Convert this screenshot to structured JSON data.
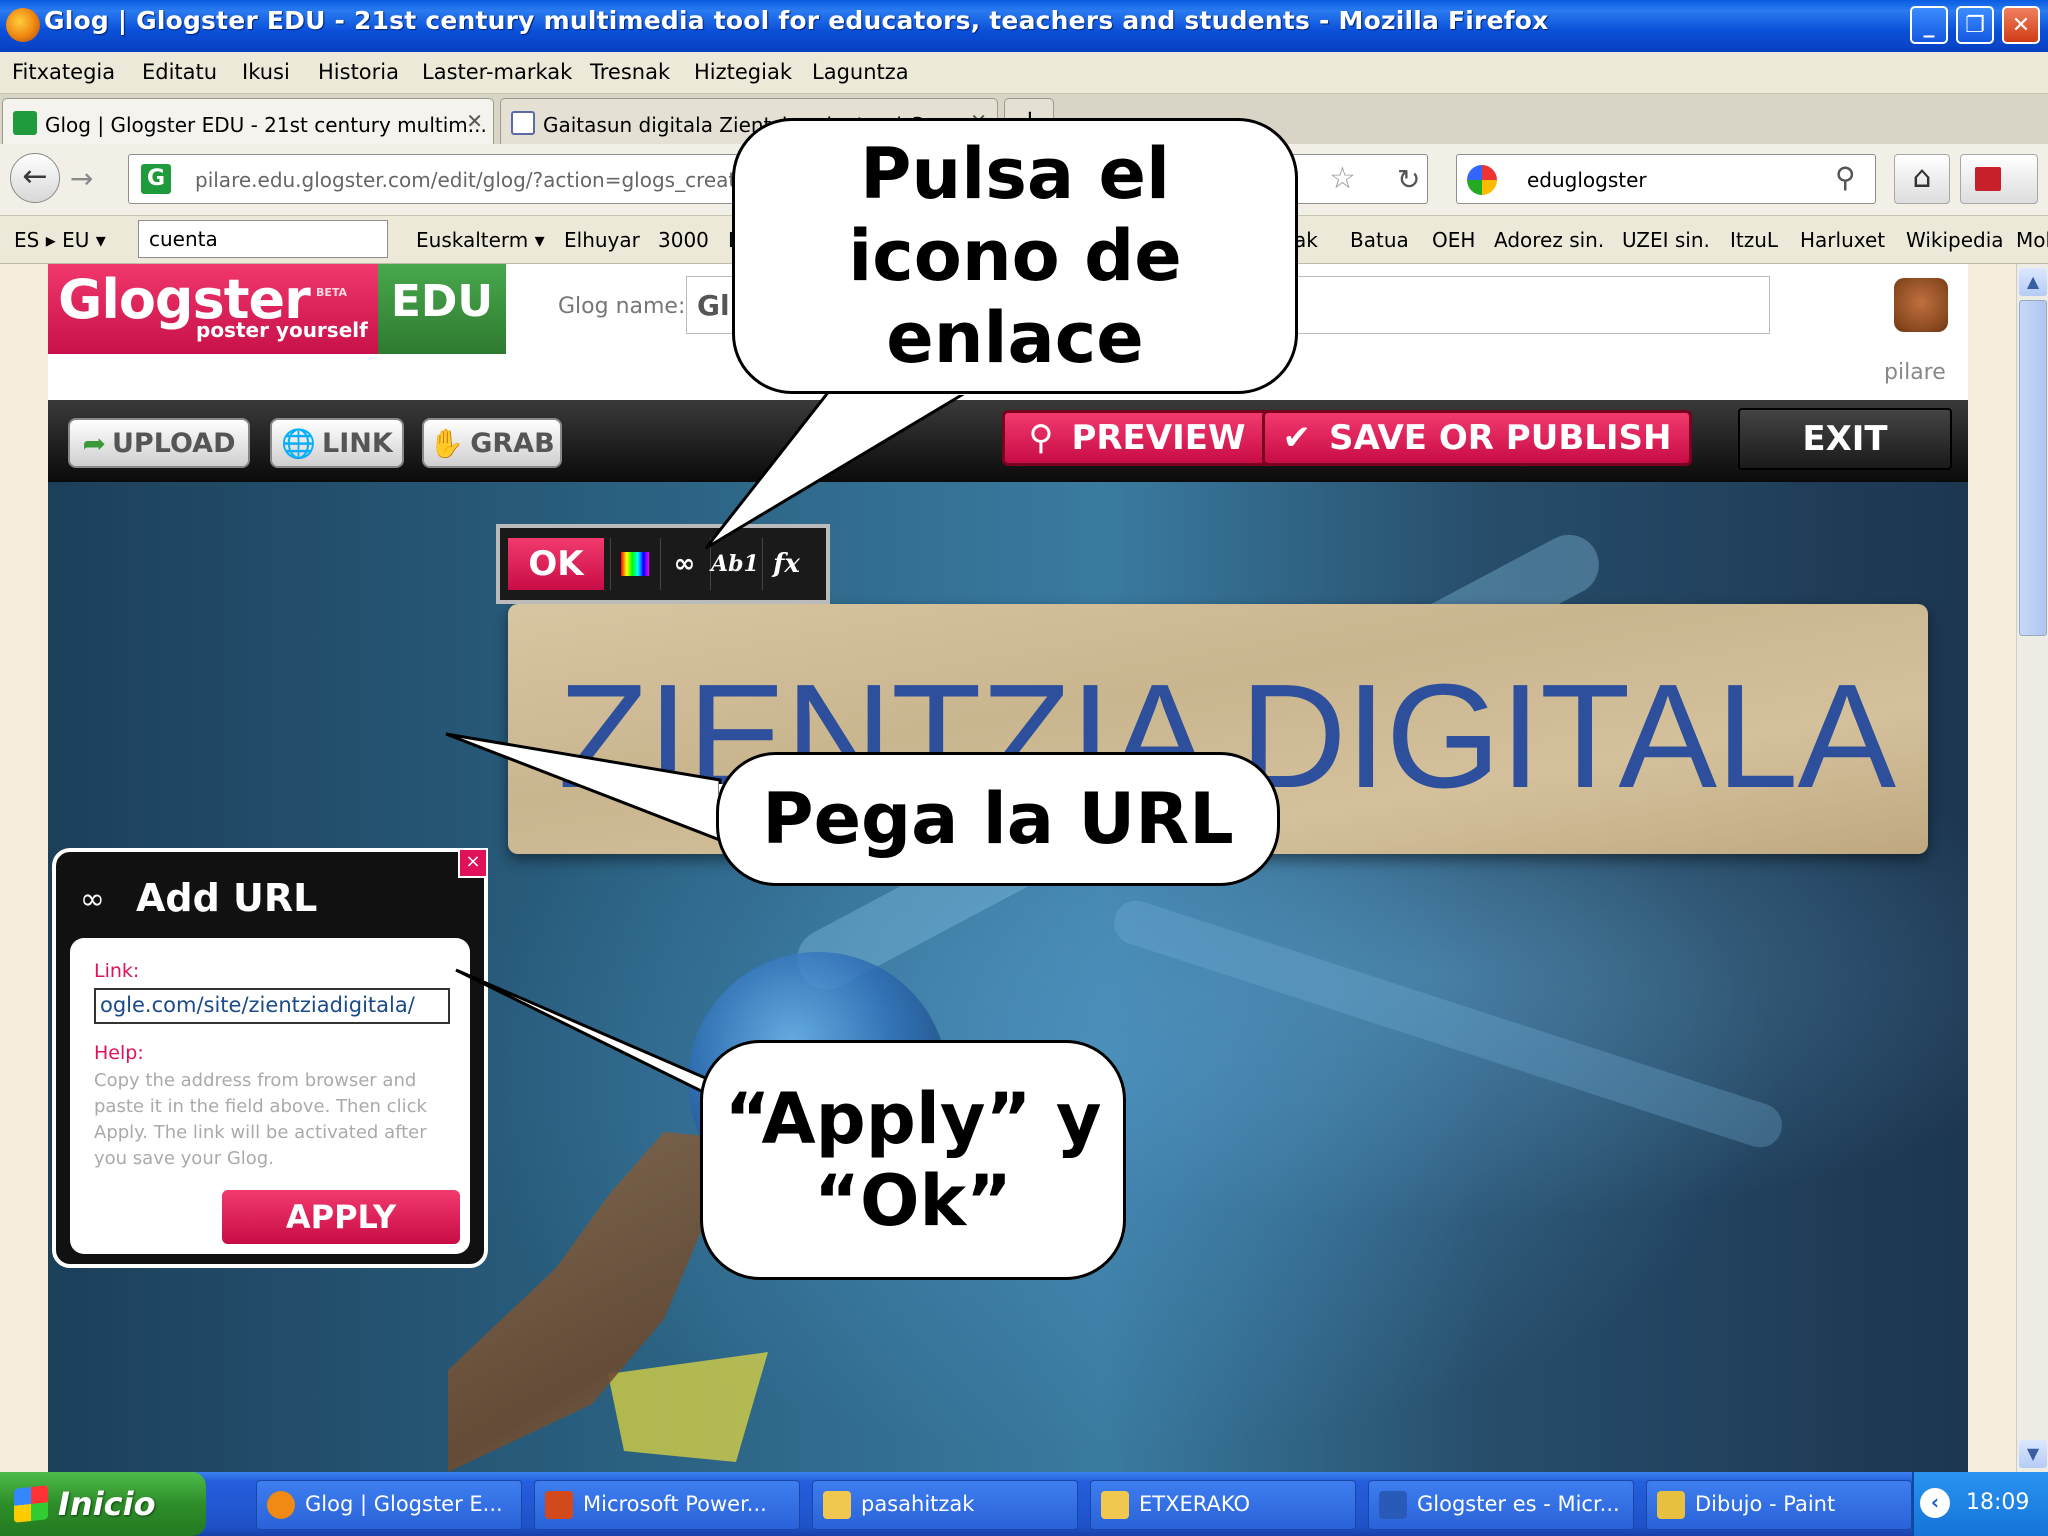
{
  "window": {
    "title": "Glog | Glogster EDU - 21st century multimedia tool for educators, teachers and students - Mozilla Firefox",
    "minimize": "_",
    "maximize": "❐",
    "close": "✕"
  },
  "menu": [
    "Fitxategia",
    "Editatu",
    "Ikusi",
    "Historia",
    "Laster-markak",
    "Tresnak",
    "Hiztegiak",
    "Laguntza"
  ],
  "tabs": [
    {
      "label": "Glog | Glogster EDU - 21st century multim...",
      "close": "✕",
      "icon": "glogster-favicon",
      "color": "#1f9a3c"
    },
    {
      "label": "Gaitasun digitala Zientzia arloetan | Go...",
      "close": "✕",
      "icon": "page-icon",
      "color": "#5a6aa8"
    }
  ],
  "new_tab": "+",
  "nav": {
    "back": "←",
    "forward": "→",
    "url": "pilare.edu.glogster.com/edit/glog/?action=glogs_create",
    "favicon": "G",
    "star": "☆",
    "reload": "↻",
    "search_value": "eduglogster",
    "search_go": "⚲",
    "home": "⌂"
  },
  "bookmarks": {
    "lang": "ES ▸ EU ▾",
    "search_value": "cuenta",
    "items_left": [
      "Euskalterm ▾",
      "Elhuyar",
      "3000",
      "L"
    ],
    "items_right": [
      "ak",
      "Batua",
      "OEH",
      "Adorez sin.",
      "UZEI sin.",
      "ItzuL",
      "Harluxet",
      "Wikipedia",
      "Mol"
    ]
  },
  "glog": {
    "logo": "Glogster",
    "logo_beta": "BETA",
    "logo_tagline": "poster yourself",
    "logo_edu": "EDU",
    "name_label": "Glog name:",
    "name_value": "Gl",
    "username": "pilare",
    "toolbar": {
      "upload": "UPLOAD",
      "link": "LINK",
      "grab": "GRAB",
      "preview": "PREVIEW",
      "save": "SAVE OR PUBLISH",
      "exit": "EXIT",
      "upload_icon": "➦",
      "link_icon": "🌐",
      "grab_icon": "✋",
      "preview_icon": "⚲",
      "save_icon": "✔"
    },
    "banner_text": "ZIENTZIA DIGITALA",
    "minibar": {
      "ok": "OK",
      "link_icon": "∞",
      "text_icon": "Ab1",
      "fx_icon": "fx"
    },
    "dialog": {
      "title": "Add URL",
      "link_icon": "∞",
      "close": "×",
      "link_label": "Link:",
      "link_value": "ogle.com/site/zientziadigitala/",
      "help_label": "Help:",
      "help_text": "Copy the address from browser and paste it in the field above. Then click Apply. The link will be activated after you save your Glog.",
      "apply": "APPLY"
    }
  },
  "callouts": {
    "icon": "Pulsa el icono de enlace",
    "url": "Pega la URL",
    "apply": "“Apply” y “Ok”"
  },
  "taskbar": {
    "start": "Inicio",
    "tasks": [
      {
        "label": "Glog | Glogster E...",
        "icon": "firefox-icon",
        "color": "#f08a14"
      },
      {
        "label": "Microsoft Power...",
        "icon": "powerpoint-icon",
        "color": "#d24a1c"
      },
      {
        "label": "pasahitzak",
        "icon": "folder-icon",
        "color": "#f0c850"
      },
      {
        "label": "ETXERAKO",
        "icon": "folder-icon",
        "color": "#f0c850"
      },
      {
        "label": "Glogster es - Micr...",
        "icon": "word-icon",
        "color": "#2a5ab8"
      },
      {
        "label": "Dibujo - Paint",
        "icon": "paint-icon",
        "color": "#e8c040"
      }
    ],
    "tray_arrow": "‹",
    "clock": "18:09"
  },
  "scrollbar": {
    "up": "▲",
    "down": "▼"
  }
}
